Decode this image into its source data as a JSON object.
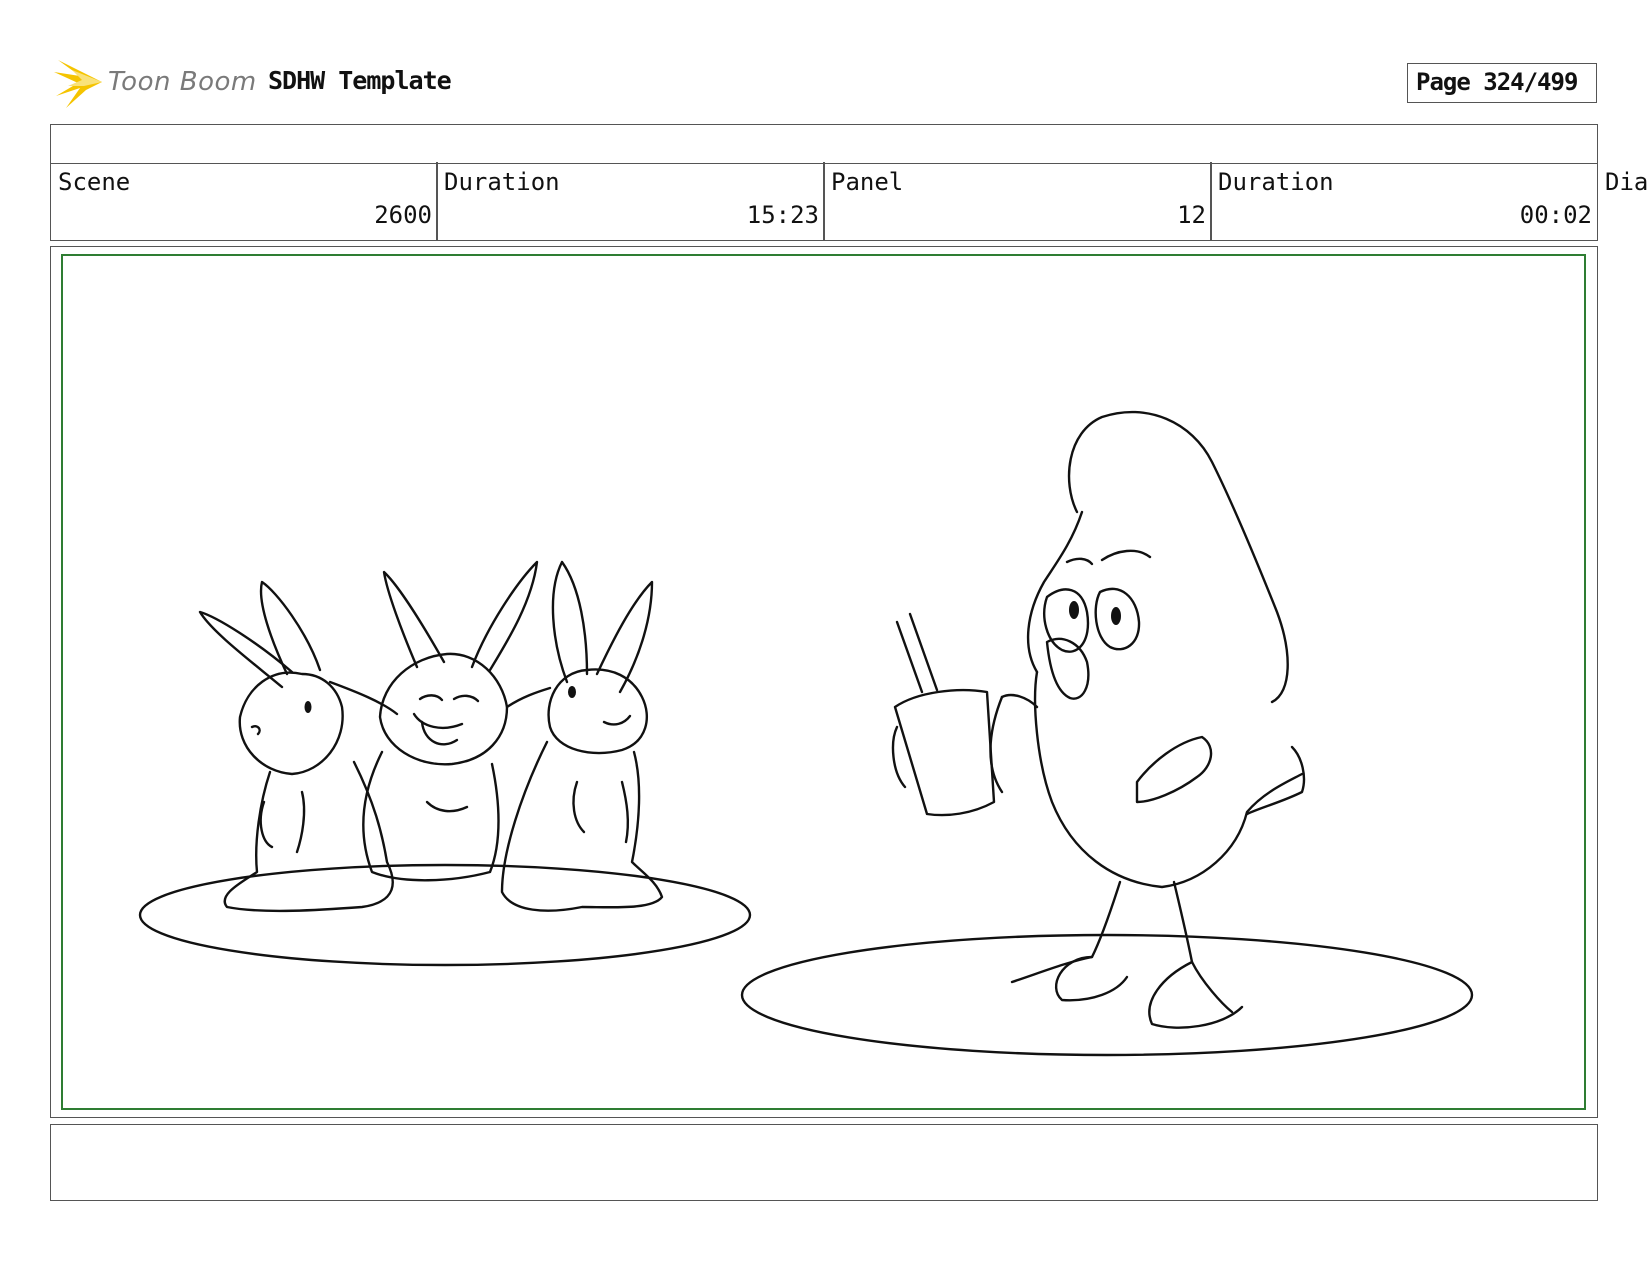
{
  "header": {
    "logo_text": "Toon Boom",
    "logo_icon": "toon-boom-burst-logo",
    "document_title": "SDHW Template",
    "page_label": "Page 324/499"
  },
  "info": {
    "scene_label": "Scene",
    "scene_value": "2600",
    "scene_duration_label": "Duration",
    "scene_duration_value": "15:23",
    "panel_label": "Panel",
    "panel_value": "12",
    "panel_duration_label": "Duration",
    "panel_duration_value": "00:02",
    "dialogue_label": "Dia"
  },
  "colors": {
    "frame_border": "#2e7d32",
    "logo_yellow": "#f5c400",
    "logo_text": "#7a7a7a"
  }
}
